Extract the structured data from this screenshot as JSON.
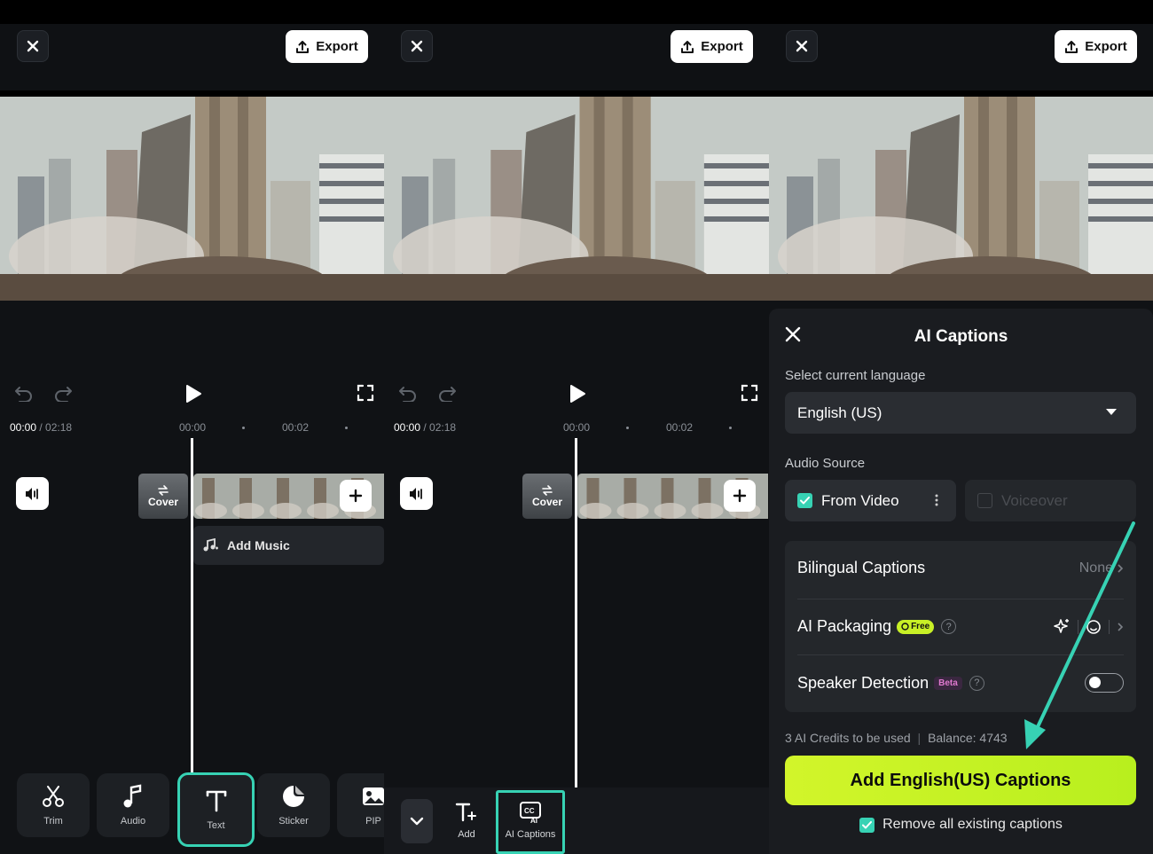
{
  "panels": [
    {
      "export_label": "Export",
      "time_current": "00:00",
      "time_total": "/ 02:18",
      "ticks": [
        "00:00",
        "00:02"
      ],
      "cover_label": "Cover",
      "add_music_label": "Add Music",
      "tools": [
        {
          "label": "Trim",
          "icon": "scissors-icon"
        },
        {
          "label": "Audio",
          "icon": "music-note-icon"
        },
        {
          "label": "Text",
          "icon": "text-icon",
          "highlighted": true
        },
        {
          "label": "Sticker",
          "icon": "sticker-icon"
        },
        {
          "label": "PIP",
          "icon": "image-icon"
        }
      ]
    },
    {
      "export_label": "Export",
      "time_current": "00:00",
      "time_total": "/ 02:18",
      "ticks": [
        "00:00",
        "00:02"
      ],
      "cover_label": "Cover",
      "tools": [
        {
          "label": "Add",
          "icon": "text-add-icon"
        },
        {
          "label": "AI Captions",
          "icon": "ai-captions-icon",
          "highlighted": true
        }
      ]
    },
    {
      "export_label": "Export",
      "sheet": {
        "title": "AI Captions",
        "language_label": "Select current language",
        "language_value": "English (US)",
        "audio_source_label": "Audio Source",
        "source_from_video": "From Video",
        "source_voiceover": "Voiceover",
        "bilingual_label": "Bilingual Captions",
        "bilingual_value": "None",
        "packaging_label": "AI Packaging",
        "packaging_badge": "Free",
        "speaker_label": "Speaker Detection",
        "speaker_badge": "Beta",
        "credits_text": "3 AI Credits to be used",
        "balance_text": "Balance: 4743",
        "cta_label": "Add English(US) Captions",
        "remove_label": "Remove all existing captions"
      }
    }
  ],
  "colors": {
    "accent_teal": "#37d2b4",
    "cta_green": "#c8f026",
    "background": "#101215"
  }
}
